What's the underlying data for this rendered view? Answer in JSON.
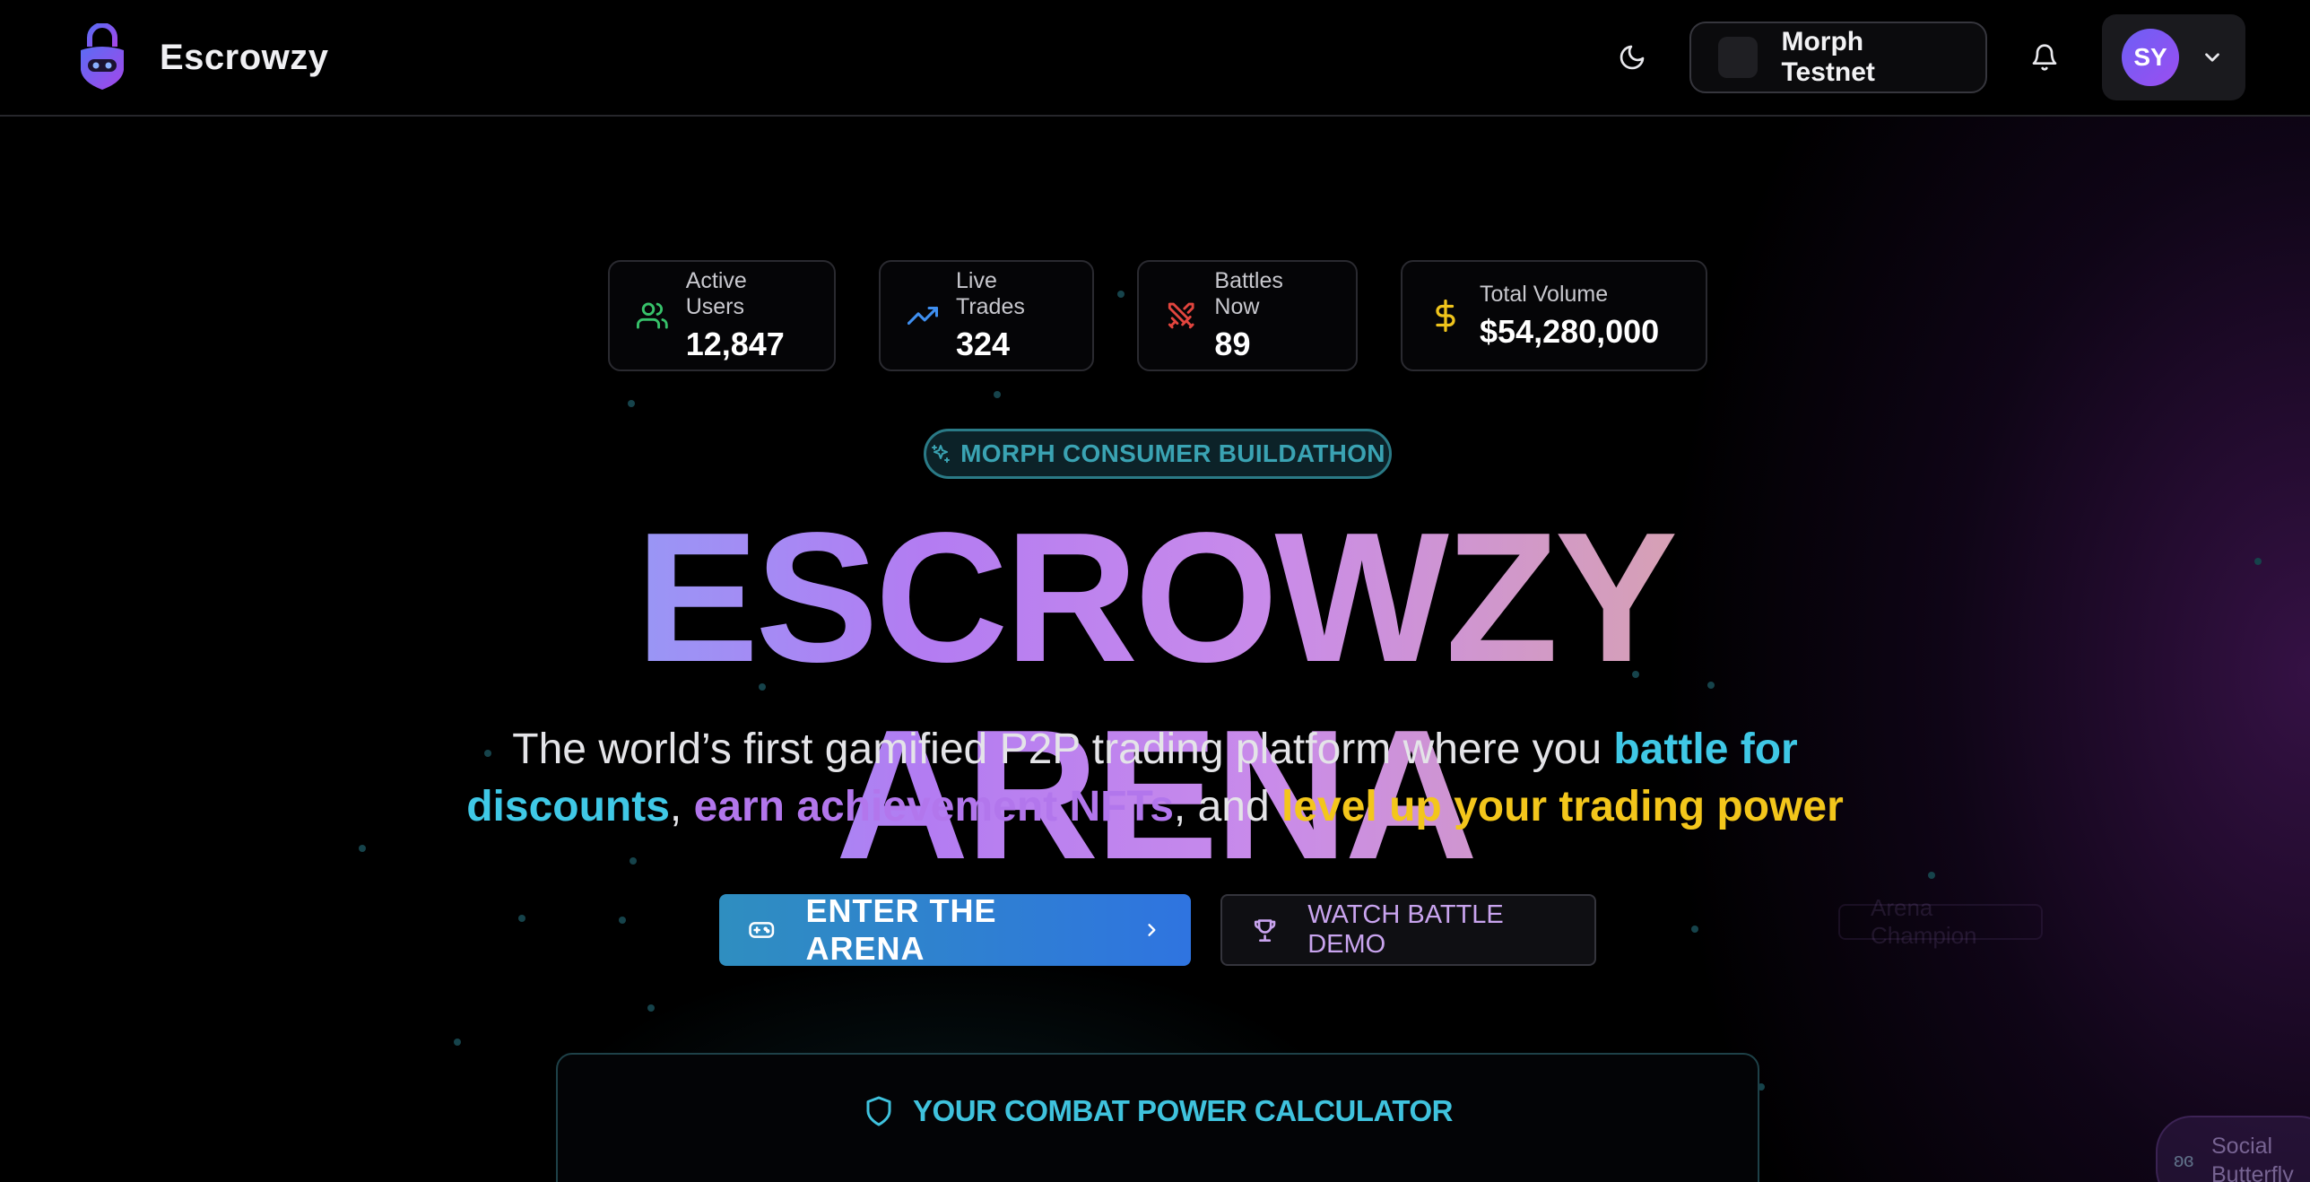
{
  "header": {
    "brand": "Escrowzy",
    "network_label": "Morph Testnet",
    "user_initials": "SY"
  },
  "stats": [
    {
      "label": "Active Users",
      "value": "12,847",
      "icon": "users-icon",
      "color": "#37c26a"
    },
    {
      "label": "Live Trades",
      "value": "324",
      "icon": "trending-up-icon",
      "color": "#3f8ff0"
    },
    {
      "label": "Battles Now",
      "value": "89",
      "icon": "swords-icon",
      "color": "#e2453e"
    },
    {
      "label": "Total Volume",
      "value": "$54,280,000",
      "icon": "dollar-icon",
      "color": "#efc41c"
    }
  ],
  "hero": {
    "badge": "MORPH CONSUMER BUILDATHON",
    "title": "ESCROWZY ARENA",
    "subtitle_parts": {
      "p1": "The world’s first gamified P2P trading platform where you ",
      "h1": "battle for discounts",
      "p2": ", ",
      "h2": "earn achievement NFTs",
      "p3": ", and ",
      "h3": "level up your trading power"
    },
    "cta_primary": "ENTER THE ARENA",
    "cta_secondary": "WATCH BATTLE DEMO"
  },
  "calculator": {
    "title": "YOUR COMBAT POWER CALCULATOR"
  },
  "floating_tags": {
    "arena_champion": "Arena Champion",
    "social_butterfly": "Social Butterfly"
  },
  "colors": {
    "accent_cyan": "#3fc8e6",
    "accent_purple": "#b276ec",
    "accent_gold": "#f3c61b",
    "primary_button": "#2f74e0"
  }
}
